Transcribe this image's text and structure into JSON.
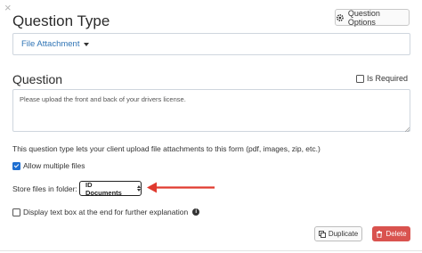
{
  "dialog": {
    "close_glyph": "×",
    "section_title": "Question Type",
    "options_button": {
      "label": "Question Options",
      "icon": "gear-icon"
    },
    "question_type": {
      "selected": "File Attachment"
    }
  },
  "question": {
    "title": "Question",
    "required_label": "Is Required",
    "required_checked": false,
    "text": "Please upload the front and back of your drivers license."
  },
  "file_settings": {
    "help_text": "This question type lets your client upload file attachments to this form (pdf, images, zip, etc.)",
    "allow_multiple_label": "Allow multiple files",
    "allow_multiple_checked": true,
    "store_label": "Store files in folder:",
    "folder_selected": "ID Documents",
    "display_text_box_label": "Display text box at the end for further explanation",
    "display_text_box_checked": false,
    "info_icon": "info-icon"
  },
  "footer": {
    "duplicate_label": "Duplicate",
    "duplicate_icon": "copy-icon",
    "delete_label": "Delete",
    "delete_icon": "trash-icon"
  },
  "colors": {
    "link_blue": "#2f74b5",
    "delete_red": "#d9534f",
    "annotation_arrow": "#e03a2f",
    "checkbox_blue": "#1f6fd1"
  }
}
